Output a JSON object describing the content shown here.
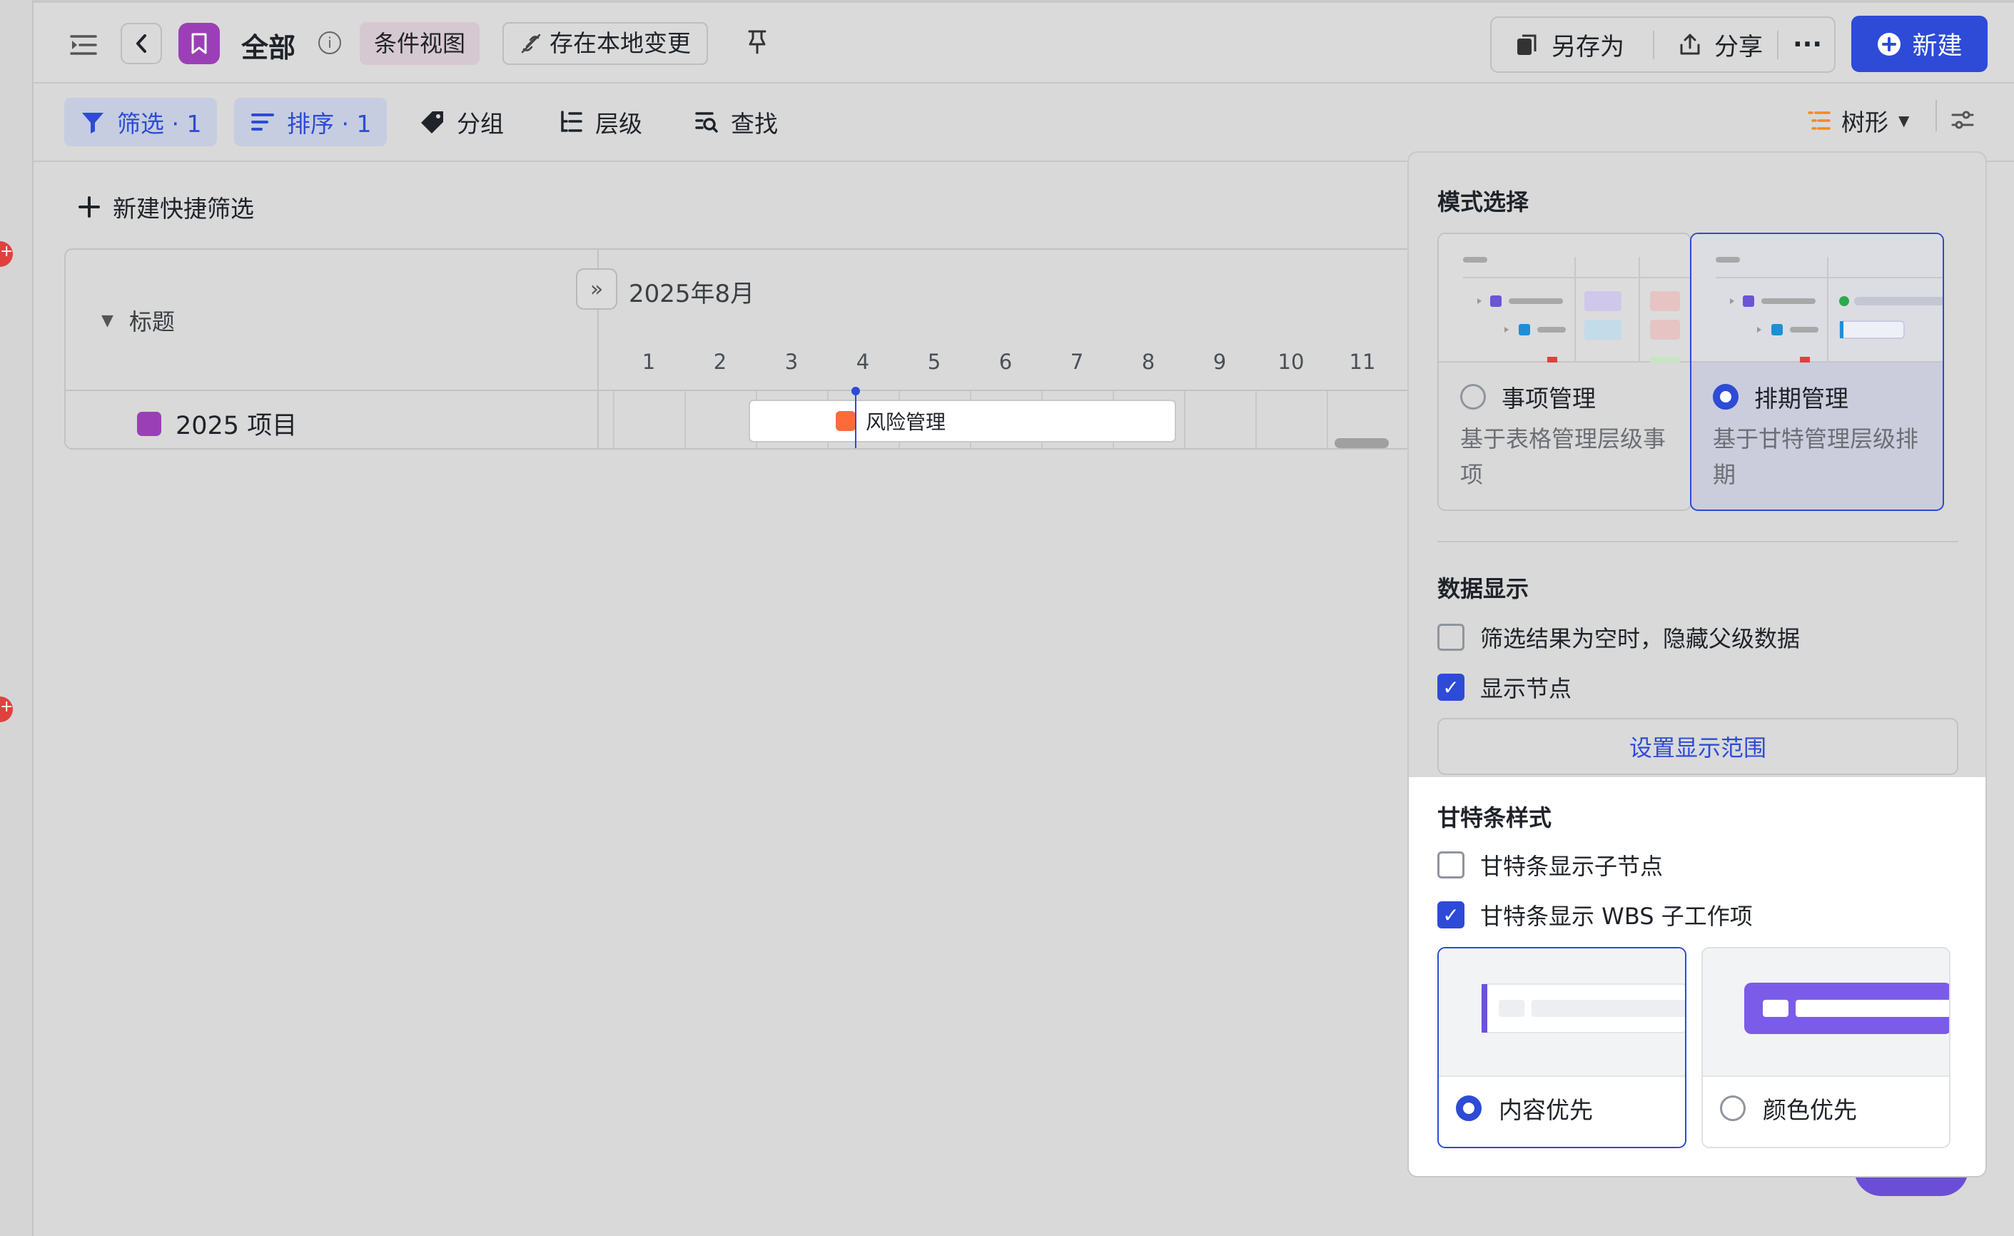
{
  "topbar": {
    "title": "全部",
    "view_chip": "条件视图",
    "save_local": "存在本地变更",
    "save_as": "另存为",
    "share": "分享",
    "new": "新建"
  },
  "toolbar": {
    "filter": "筛选 · 1",
    "sort": "排序 · 1",
    "group": "分组",
    "level": "层级",
    "find": "查找",
    "view_mode": "树形"
  },
  "main": {
    "quick_filter": "新建快捷筛选",
    "column_title": "标题",
    "month": "2025年8月",
    "days": [
      "1",
      "2",
      "3",
      "4",
      "5",
      "6",
      "7",
      "8",
      "9",
      "10",
      "11"
    ],
    "row_label": "2025 项目",
    "bar_label": "风险管理"
  },
  "panel": {
    "mode_title": "模式选择",
    "modes": [
      {
        "title": "事项管理",
        "desc": "基于表格管理层级事项",
        "selected": false
      },
      {
        "title": "排期管理",
        "desc": "基于甘特管理层级排期",
        "selected": true
      }
    ],
    "data_title": "数据显示",
    "hide_parent": "筛选结果为空时，隐藏父级数据",
    "show_nodes": "显示节点",
    "set_range": "设置显示范围",
    "gantt_title": "甘特条样式",
    "gantt_children": "甘特条显示子节点",
    "gantt_wbs": "甘特条显示 WBS 子工作项",
    "styles": [
      {
        "label": "内容优先",
        "selected": true
      },
      {
        "label": "颜色优先",
        "selected": false
      }
    ]
  },
  "colors": {
    "accent": "#2d4bd6",
    "brand_purple": "#9b3fb6",
    "bar_orange": "#ff6a3d"
  }
}
